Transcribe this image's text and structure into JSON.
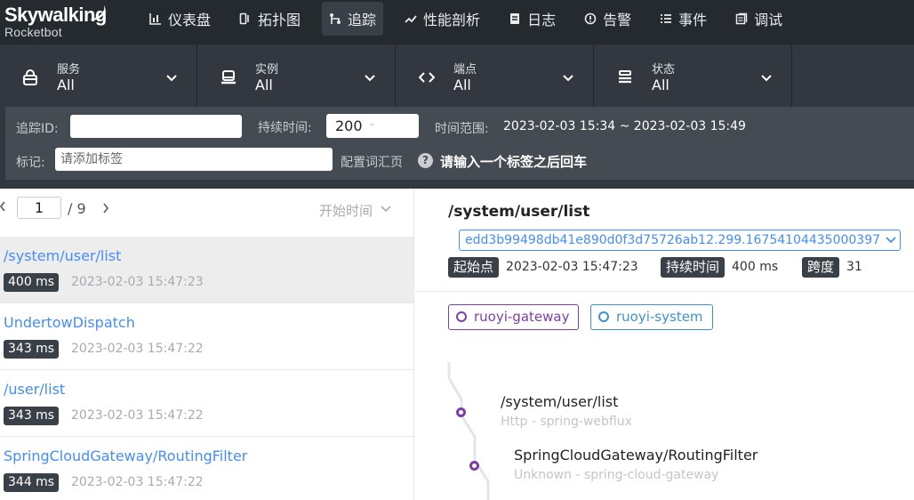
{
  "app": {
    "logo_line1": "Skywalking",
    "logo_line2": "Rocketbot"
  },
  "nav": [
    {
      "label": "仪表盘",
      "icon": "dashboard-icon",
      "active": false
    },
    {
      "label": "拓扑图",
      "icon": "topology-icon",
      "active": false
    },
    {
      "label": "追踪",
      "icon": "trace-icon",
      "active": true
    },
    {
      "label": "性能剖析",
      "icon": "profile-icon",
      "active": false
    },
    {
      "label": "日志",
      "icon": "log-icon",
      "active": false
    },
    {
      "label": "告警",
      "icon": "alarm-icon",
      "active": false
    },
    {
      "label": "事件",
      "icon": "event-icon",
      "active": false
    },
    {
      "label": "调试",
      "icon": "debug-icon",
      "active": false
    }
  ],
  "filters": {
    "service": {
      "label": "服务",
      "value": "All"
    },
    "instance": {
      "label": "实例",
      "value": "All"
    },
    "endpoint": {
      "label": "端点",
      "value": "All"
    },
    "status": {
      "label": "状态",
      "value": "All"
    }
  },
  "search": {
    "trace_id_label": "追踪ID:",
    "trace_id_value": "",
    "duration_label": "持续时间:",
    "duration_min": "200",
    "duration_sep": "-",
    "duration_max": "",
    "time_range_label": "时间范围:",
    "time_range_value": "2023-02-03 15:34 ~ 2023-02-03 15:49",
    "tags_label": "标记:",
    "tags_placeholder": "请添加标签",
    "config_link": "配置词汇页",
    "help_glyph": "?",
    "hint": "请输入一个标签之后回车"
  },
  "pager": {
    "current_page": "1",
    "total": "/ 9",
    "sort_label": "开始时间"
  },
  "traces": [
    {
      "name": "/system/user/list",
      "duration": "400 ms",
      "time": "2023-02-03 15:47:23",
      "selected": true
    },
    {
      "name": "UndertowDispatch",
      "duration": "343 ms",
      "time": "2023-02-03 15:47:22",
      "selected": false
    },
    {
      "name": "/user/list",
      "duration": "343 ms",
      "time": "2023-02-03 15:47:22",
      "selected": false
    },
    {
      "name": "SpringCloudGateway/RoutingFilter",
      "duration": "344 ms",
      "time": "2023-02-03 15:47:22",
      "selected": false
    }
  ],
  "detail": {
    "title": "/system/user/list",
    "trace_id": "edd3b99498db41e890d0f3d75726ab12.299.16754104435000397",
    "start_label": "起始点",
    "start_value": "2023-02-03 15:47:23",
    "duration_label": "持续时间",
    "duration_value": "400 ms",
    "span_label": "跨度",
    "span_value": "31",
    "services": [
      {
        "name": "ruoyi-gateway",
        "color": "#7b3fa6"
      },
      {
        "name": "ruoyi-system",
        "color": "#3d92d0"
      }
    ],
    "spans": [
      {
        "name": "/system/user/list",
        "sub": "Http - spring-webflux"
      },
      {
        "name": "SpringCloudGateway/RoutingFilter",
        "sub": "Unknown - spring-cloud-gateway"
      }
    ]
  },
  "colors": {
    "link": "#448dfe",
    "dark": "#252a2f",
    "gateway": "#7b3fa6",
    "system": "#3d92d0"
  }
}
